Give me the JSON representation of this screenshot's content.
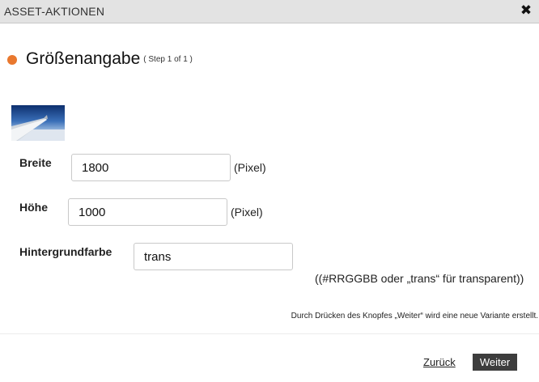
{
  "window": {
    "title": "ASSET-AKTIONEN",
    "close_icon": "close-x-icon"
  },
  "step": {
    "title": "Größenangabe",
    "counter": "( Step 1 of 1 )",
    "dot_color": "#e9782e"
  },
  "preview": {
    "image": "airplane-wing-sky-thumbnail"
  },
  "form": {
    "width_label": "Breite",
    "width_value": "1800",
    "width_unit": "(Pixel)",
    "height_label": "Höhe",
    "height_value": "1000",
    "height_unit": "(Pixel)",
    "bg_label": "Hintergrundfarbe",
    "bg_value": "trans",
    "bg_hint": "((#RRGGBB oder „trans“ für transparent))"
  },
  "info_note": "Durch Drücken des Knopfes „Weiter“ wird eine neue Variante erstellt.",
  "footer": {
    "back_label": "Zurück",
    "next_label": "Weiter"
  }
}
